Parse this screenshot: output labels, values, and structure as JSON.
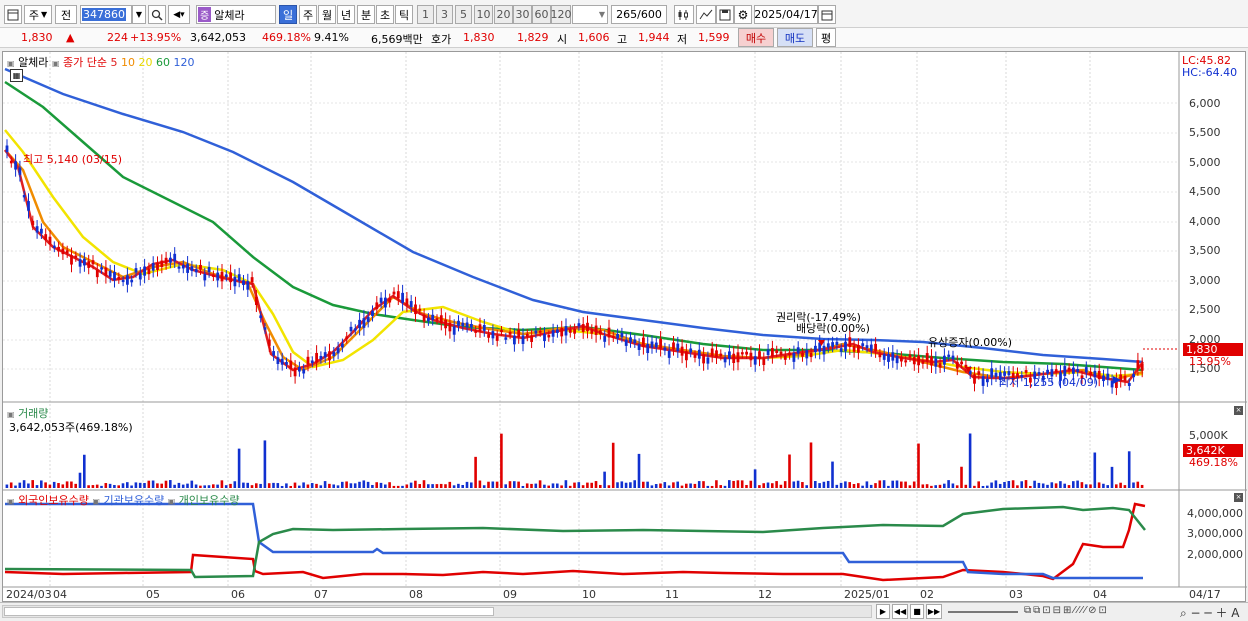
{
  "toolbar": {
    "mode": "주",
    "prev": "전",
    "code": "347860",
    "name_badge": "증",
    "name": "알체라",
    "periods": [
      "일",
      "주",
      "월",
      "년",
      "분",
      "초",
      "틱"
    ],
    "nums": [
      "1",
      "3",
      "5",
      "10",
      "20",
      "30",
      "60",
      "120"
    ],
    "count": "265",
    "count_total": "/600",
    "date": "2025/04/17"
  },
  "quote": {
    "price": "1,830",
    "change": "224",
    "change_pct": "+13.95%",
    "volume": "3,642,053",
    "volume_ratio": "469.18%",
    "turnover": "9.41%",
    "amount": "6,569백만",
    "hoga_label": "호가",
    "ask": "1,830",
    "bid": "1,829",
    "open_label": "시",
    "open": "1,606",
    "high_label": "고",
    "high": "1,944",
    "low_label": "저",
    "low": "1,599",
    "buy": "매수",
    "sell": "매도",
    "eval": "평"
  },
  "price_pane": {
    "name": "알체라",
    "ma_label": "종가 단순",
    "ma_periods": [
      {
        "p": "5",
        "color": "#e02020"
      },
      {
        "p": "10",
        "color": "#f08c00"
      },
      {
        "p": "20",
        "color": "#e8d800"
      },
      {
        "p": "60",
        "color": "#1a9a3a"
      },
      {
        "p": "120",
        "color": "#3060d8"
      }
    ],
    "lc": "LC:45.82",
    "hc": "HC:-64.40",
    "y_ticks": [
      "6,000",
      "5,500",
      "5,000",
      "4,500",
      "4,000",
      "3,500",
      "3,000",
      "2,500",
      "2,000",
      "1,500"
    ],
    "current_price": "1,830",
    "current_pct": "13.95%",
    "high_note": "최고 5,140 (03/15)",
    "low_note": "최저 1,255 (04/09)",
    "events": [
      "권리락(-17.49%)",
      "배당락(0.00%)",
      "유상증자(0.00%)"
    ]
  },
  "volume_pane": {
    "title": "거래량",
    "value": "3,642,053주(469.18%)",
    "y_tick": "5,000K",
    "current": "3,642K",
    "current_pct": "469.18%"
  },
  "holdings_pane": {
    "legend": [
      "외국인보유수량",
      "기관보유수량",
      "개인보유수량"
    ],
    "legend_colors": [
      "#e00000",
      "#3060d8",
      "#2a8a4a"
    ],
    "y_ticks": [
      "4,000,000",
      "3,000,000",
      "2,000,000"
    ]
  },
  "x_axis": [
    "2024/03",
    "04",
    "05",
    "06",
    "07",
    "08",
    "09",
    "10",
    "11",
    "12",
    "2025/01",
    "02",
    "03",
    "04"
  ],
  "x_axis_end": "04/17"
}
